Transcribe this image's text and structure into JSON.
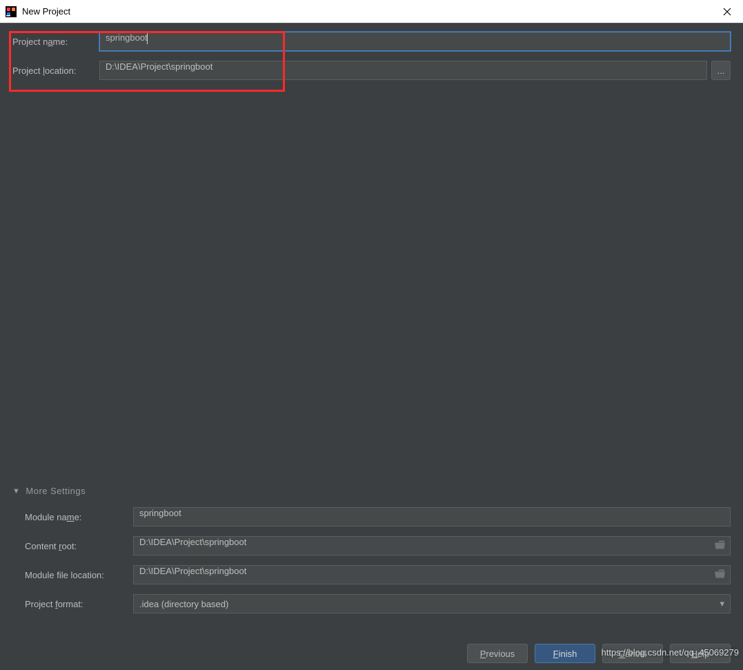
{
  "window": {
    "title": "New Project"
  },
  "form": {
    "project_name": {
      "label_pre": "Project n",
      "label_ul": "a",
      "label_post": "me:",
      "value": "springboot"
    },
    "project_location": {
      "label_pre": "Project ",
      "label_ul": "l",
      "label_post": "ocation:",
      "value": "D:\\IDEA\\Project\\springboot",
      "browse": "..."
    }
  },
  "more": {
    "header": {
      "label_pre": "Mor",
      "label_ul": "e",
      "label_post": " Settings"
    },
    "module_name": {
      "label_pre": "Module na",
      "label_ul": "m",
      "label_post": "e:",
      "value": "springboot"
    },
    "content_root": {
      "label_pre": "Content ",
      "label_ul": "r",
      "label_post": "oot:",
      "value": "D:\\IDEA\\Project\\springboot"
    },
    "module_file_location": {
      "label": "Module file location:",
      "value": "D:\\IDEA\\Project\\springboot"
    },
    "project_format": {
      "label_pre": "Project ",
      "label_ul": "f",
      "label_post": "ormat:",
      "value": ".idea (directory based)"
    }
  },
  "buttons": {
    "previous": {
      "ul": "P",
      "post": "revious"
    },
    "finish": {
      "ul": "F",
      "post": "inish"
    },
    "cancel": {
      "ul": "C",
      "post": "ancel"
    },
    "help": {
      "ul": "H",
      "post": "elp"
    }
  },
  "watermark": "https://blog.csdn.net/qq_45069279"
}
